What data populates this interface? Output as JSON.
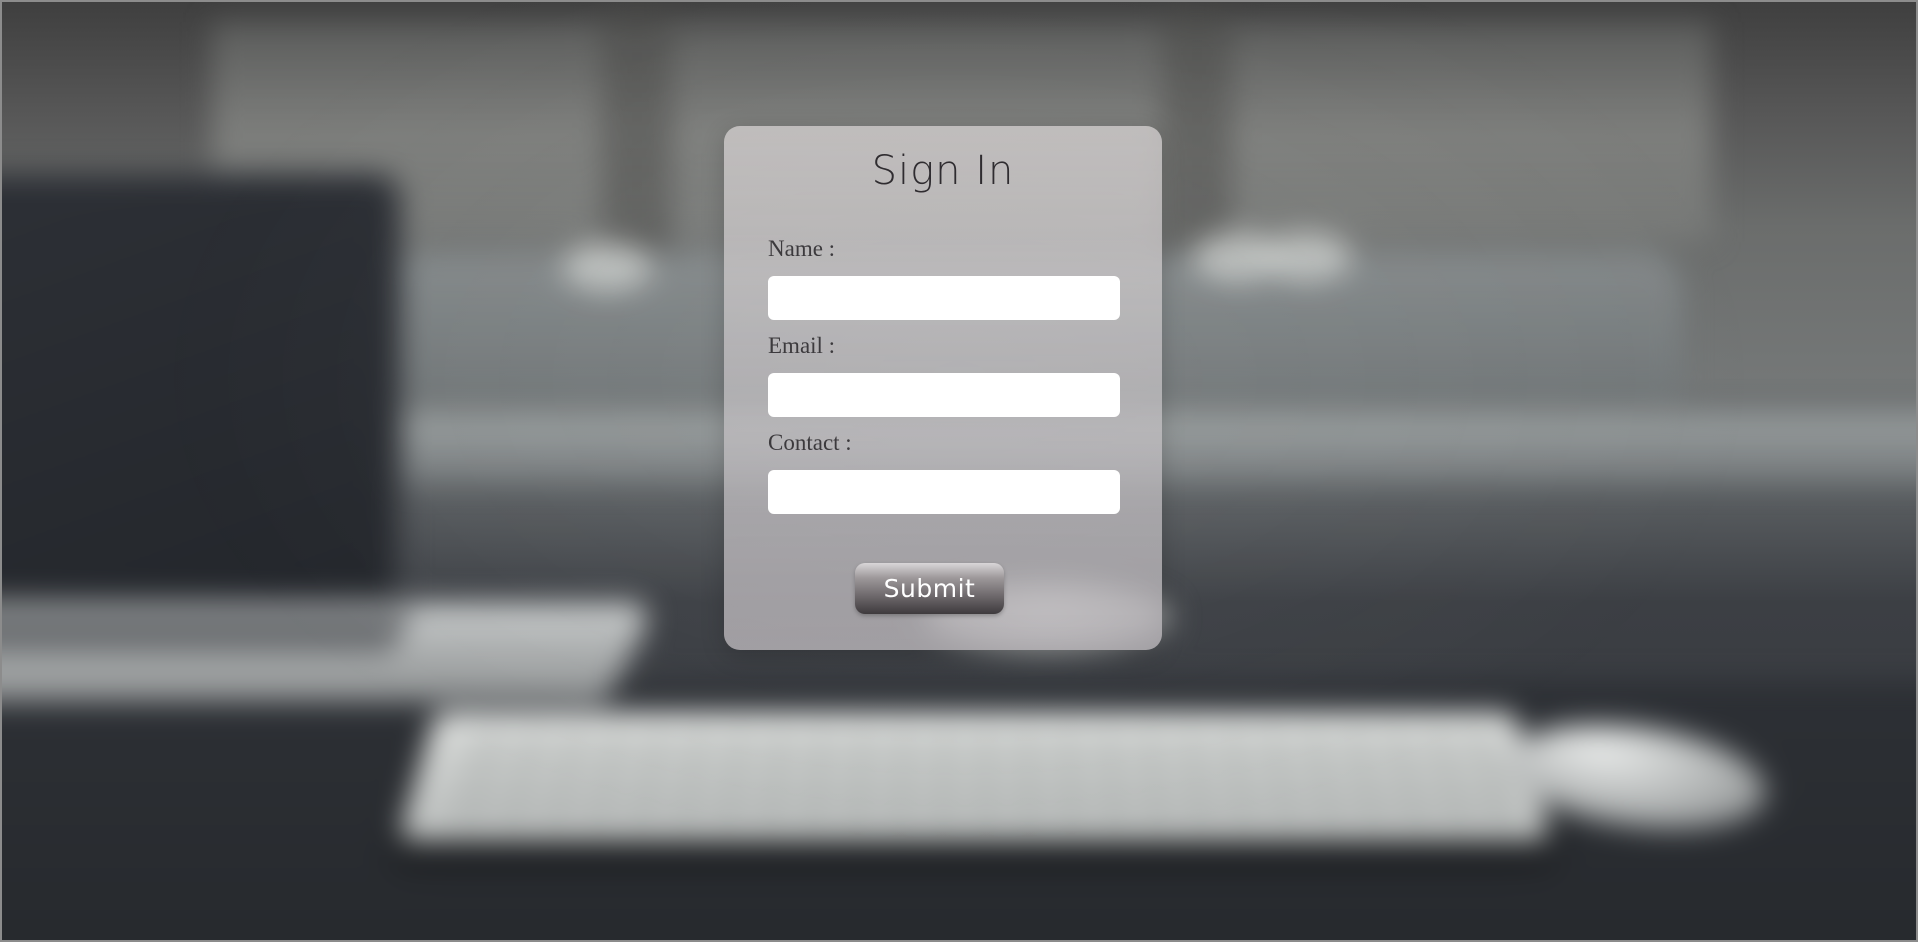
{
  "form": {
    "title": "Sign In",
    "fields": [
      {
        "label": "Name :",
        "value": "",
        "placeholder": ""
      },
      {
        "label": "Email :",
        "value": "",
        "placeholder": ""
      },
      {
        "label": "Contact :",
        "value": "",
        "placeholder": ""
      }
    ],
    "submit_label": "Submit"
  },
  "colors": {
    "card_background": "#c8c4c7",
    "title_text": "#2f2c30",
    "label_text": "#3c3a3d",
    "button_gradient_top": "#d9d6d8",
    "button_gradient_bottom": "#3e3a3d",
    "button_text": "#ffffff"
  },
  "background": {
    "icon": "blurred-desk-photo"
  }
}
